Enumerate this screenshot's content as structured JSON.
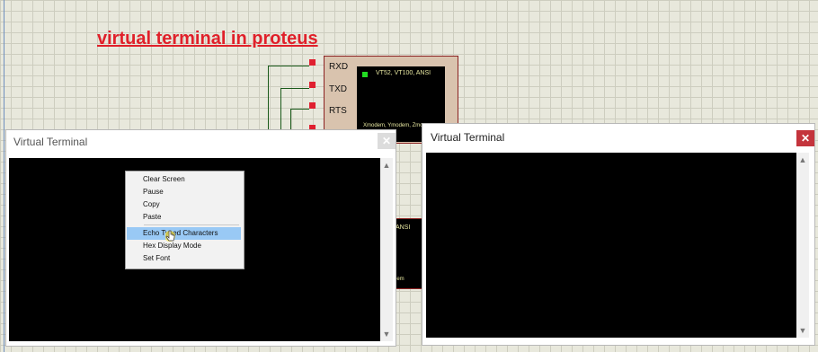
{
  "annotation": {
    "title": "virtual terminal in proteus"
  },
  "component": {
    "pins": [
      "RXD",
      "TXD",
      "RTS"
    ],
    "screen_text": "VT52, VT100, ANSI",
    "footer_text": "Xmodem, Ymodem, Zmo",
    "led_color": "#22dd22"
  },
  "component2": {
    "screen_text": "ANSI",
    "footer_text": "dem"
  },
  "window_left": {
    "title": "Virtual Terminal",
    "close_icon": "close-icon"
  },
  "window_right": {
    "title": "Virtual Terminal",
    "close_icon": "close-icon",
    "close_color": "#c4343c"
  },
  "context_menu": {
    "items": [
      "Clear Screen",
      "Pause",
      "Copy",
      "Paste",
      "Echo Typed Characters",
      "Hex Display Mode",
      "Set Font"
    ],
    "highlighted": "Echo Typed Characters"
  },
  "scroll_icons": {
    "up": "▲",
    "down": "▼"
  }
}
